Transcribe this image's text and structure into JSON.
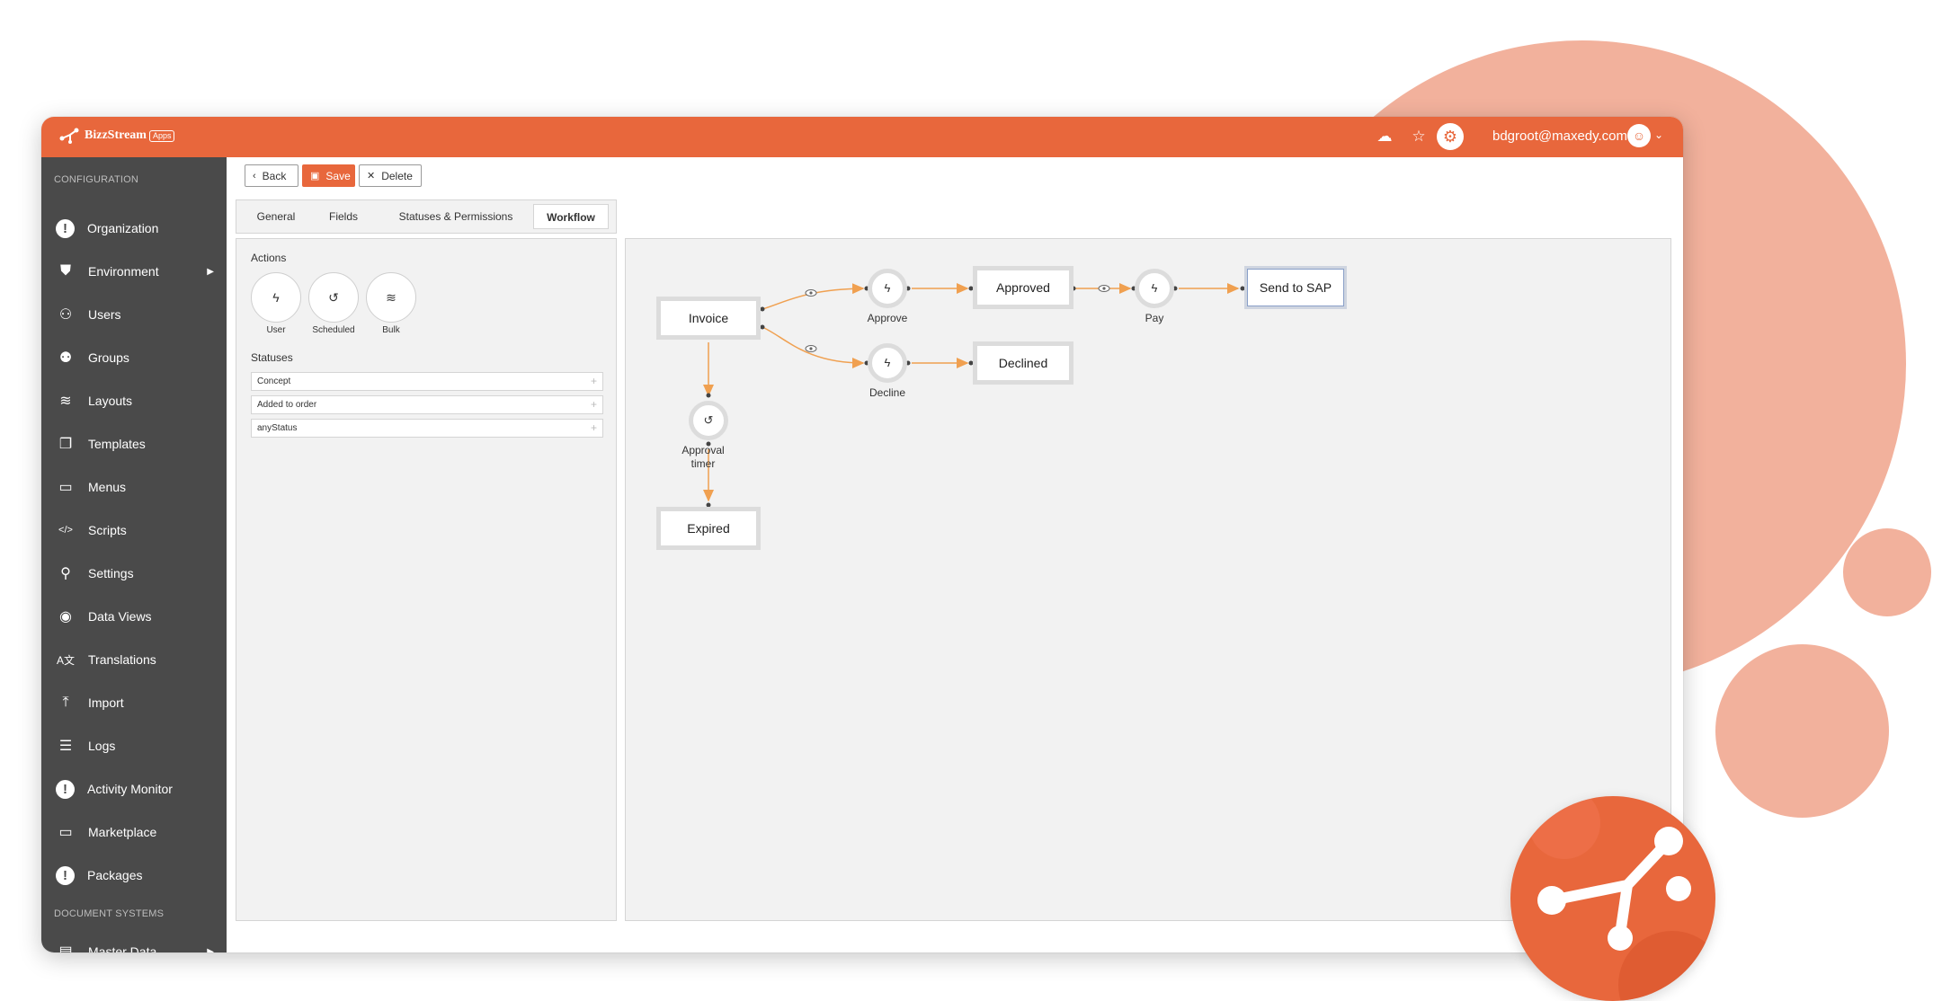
{
  "app": {
    "name": "BizzStream",
    "badge": "Apps",
    "user_email": "bdgroot@maxedy.com"
  },
  "colors": {
    "accent": "#e8673c",
    "sidebar": "#4a4a4a",
    "decor": "#f2b19c",
    "edge": "#f0a050"
  },
  "topbar_icons": [
    "cloud-icon",
    "star-icon",
    "gear-icon",
    "user-icon"
  ],
  "sidebar": {
    "sections": [
      "CONFIGURATION",
      "DOCUMENT SYSTEMS"
    ],
    "items": [
      {
        "label": "Organization",
        "icon": "alert-icon"
      },
      {
        "label": "Environment",
        "icon": "environment-icon"
      },
      {
        "label": "Users",
        "icon": "user-icon"
      },
      {
        "label": "Groups",
        "icon": "groups-icon"
      },
      {
        "label": "Layouts",
        "icon": "layers-icon"
      },
      {
        "label": "Templates",
        "icon": "templates-icon"
      },
      {
        "label": "Menus",
        "icon": "menu-icon"
      },
      {
        "label": "Scripts",
        "icon": "code-icon"
      },
      {
        "label": "Settings",
        "icon": "settings-icon"
      },
      {
        "label": "Data Views",
        "icon": "eye-icon"
      },
      {
        "label": "Translations",
        "icon": "translate-icon"
      },
      {
        "label": "Import",
        "icon": "import-icon"
      },
      {
        "label": "Logs",
        "icon": "logs-icon"
      },
      {
        "label": "Activity Monitor",
        "icon": "alert-icon"
      },
      {
        "label": "Marketplace",
        "icon": "monitor-icon"
      },
      {
        "label": "Packages",
        "icon": "alert-icon"
      },
      {
        "label": "Master Data",
        "icon": "folder-icon"
      }
    ]
  },
  "toolbar": {
    "back_label": "Back",
    "save_label": "Save",
    "delete_label": "Delete"
  },
  "tabs": [
    "General",
    "Fields",
    "Statuses & Permissions",
    "Workflow"
  ],
  "active_tab": "Workflow",
  "actions_panel": {
    "title": "Actions",
    "actions": [
      "User",
      "Scheduled",
      "Bulk"
    ],
    "statuses_title": "Statuses",
    "statuses": [
      "Concept",
      "Added to order",
      "anyStatus"
    ]
  },
  "workflow": {
    "statuses": [
      "Invoice",
      "Approved",
      "Send to SAP",
      "Declined",
      "Expired"
    ],
    "actions": [
      "Approve",
      "Pay",
      "Decline",
      "Approval timer"
    ]
  }
}
